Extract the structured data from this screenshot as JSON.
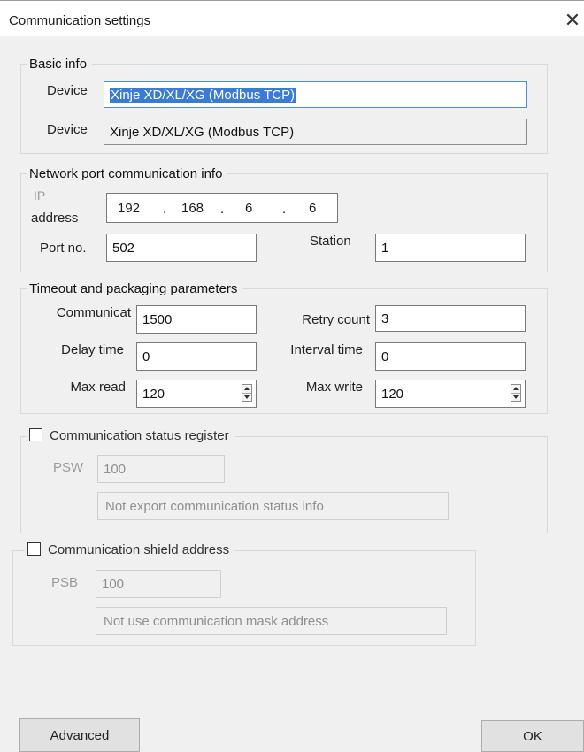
{
  "window": {
    "title": "Communication settings",
    "close_glyph": "✕"
  },
  "basic": {
    "legend": "Basic info",
    "device1_label": "Device",
    "device1_value": "Xinje XD/XL/XG (Modbus TCP)",
    "device2_label": "Device",
    "device2_value": "Xinje XD/XL/XG (Modbus TCP)"
  },
  "network": {
    "legend": "Network port communication info",
    "ip_label_line1": "IP",
    "ip_label_line2": "address",
    "ip": [
      "192",
      "168",
      "6",
      "6"
    ],
    "ip_separator": ".",
    "port_label": "Port no.",
    "port_value": "502",
    "station_label": "Station",
    "station_value": "1"
  },
  "timeout": {
    "legend": "Timeout and packaging parameters",
    "comm_label": "Communicat",
    "comm_value": "1500",
    "retry_label": "Retry count",
    "retry_value": "3",
    "delay_label": "Delay time",
    "delay_value": "0",
    "interval_label": "Interval time",
    "interval_value": "0",
    "maxread_label": "Max read",
    "maxread_value": "120",
    "maxwrite_label": "Max write",
    "maxwrite_value": "120"
  },
  "status_register": {
    "legend": "Communication status register",
    "checked": false,
    "psw_label": "PSW",
    "psw_value": "100",
    "info_value": "Not export communication status info"
  },
  "shield": {
    "legend": "Communication shield address",
    "checked": false,
    "psb_label": "PSB",
    "psb_value": "100",
    "info_value": "Not use communication mask address"
  },
  "buttons": {
    "advanced": "Advanced",
    "ok": "OK"
  },
  "icons": {
    "close": "close-icon",
    "spin": "spinner-arrows-icon",
    "checkbox": "checkbox-icon"
  }
}
